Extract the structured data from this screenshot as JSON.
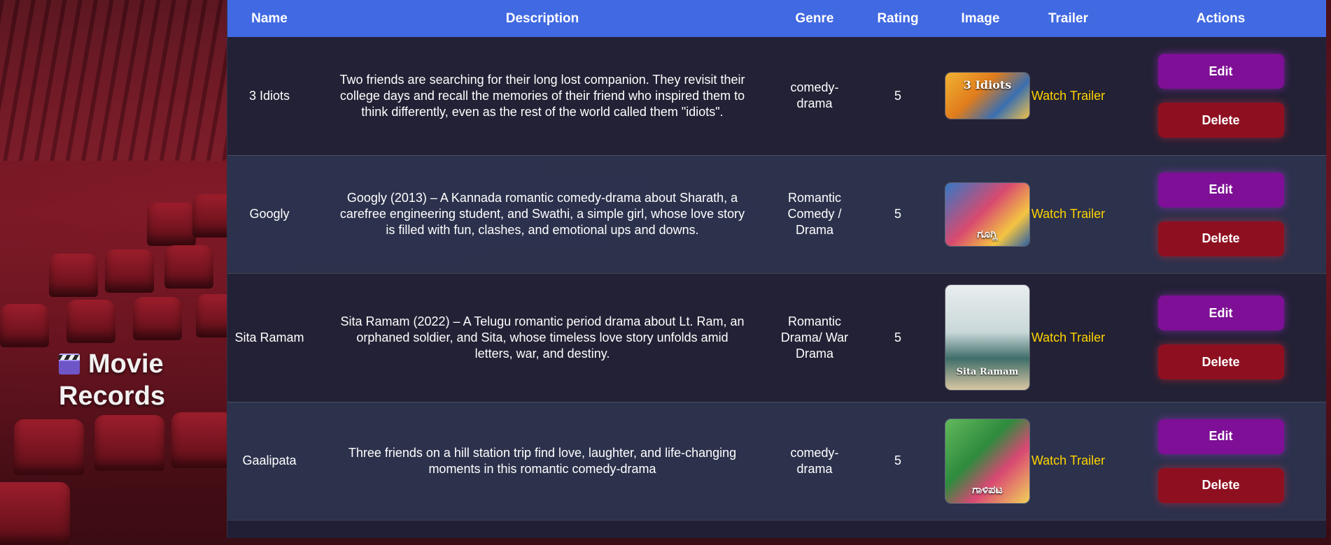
{
  "app": {
    "brand": "Movie Records",
    "brand_icon": "clapperboard-icon"
  },
  "colors": {
    "header": "#4169e1",
    "edit": "#7e0f96",
    "delete": "#8e1020",
    "trailer_link": "#ffd400"
  },
  "table": {
    "headers": [
      "Name",
      "Description",
      "Genre",
      "Rating",
      "Image",
      "Trailer",
      "Actions"
    ],
    "rows": [
      {
        "name": "3 Idiots",
        "description": "Two friends are searching for their long lost companion. They revisit their college days and recall the memories of their friend who inspired them to think differently, even as the rest of the world called them \"idiots\".",
        "genre": "comedy-drama",
        "rating": "5",
        "poster_text": "3 Idiots",
        "trailer": "Watch Trailer",
        "edit": "Edit",
        "delete": "Delete"
      },
      {
        "name": "Googly",
        "description": "Googly (2013) – A Kannada romantic comedy-drama about Sharath, a carefree engineering student, and Swathi, a simple girl, whose love story is filled with fun, clashes, and emotional ups and downs.",
        "genre": "Romantic Comedy / Drama",
        "rating": "5",
        "poster_text": "ಗೂಗ್ಲಿ",
        "trailer": "Watch Trailer",
        "edit": "Edit",
        "delete": "Delete"
      },
      {
        "name": "Sita Ramam",
        "description": "Sita Ramam (2022) – A Telugu romantic period drama about Lt. Ram, an orphaned soldier, and Sita, whose timeless love story unfolds amid letters, war, and destiny.",
        "genre": "Romantic Drama/ War Drama",
        "rating": "5",
        "poster_text": "Sita Ramam",
        "trailer": "Watch Trailer",
        "edit": "Edit",
        "delete": "Delete"
      },
      {
        "name": "Gaalipata",
        "description": "Three friends on a hill station trip find love, laughter, and life-changing moments in this romantic comedy-drama",
        "genre": "comedy-drama",
        "rating": "5",
        "poster_text": "ಗಾಳಿಪಟ",
        "trailer": "Watch Trailer",
        "edit": "Edit",
        "delete": "Delete"
      }
    ]
  }
}
